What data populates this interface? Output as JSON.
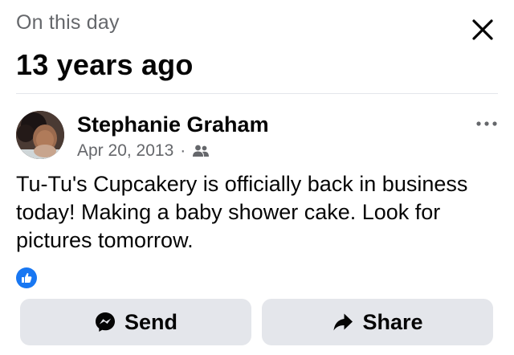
{
  "header": {
    "kicker": "On this day",
    "title": "13 years ago",
    "close_icon": "close-icon"
  },
  "post": {
    "author": "Stephanie Graham",
    "date": "Apr 20, 2013",
    "separator": "·",
    "audience_icon": "friends-icon",
    "more_icon": "more-horizontal-icon",
    "text": "Tu-Tu's Cupcakery is officially back in business today!  Making a baby shower cake.  Look for pictures tomorrow.",
    "reaction_icon": "like-icon"
  },
  "actions": {
    "send_label": "Send",
    "send_icon": "messenger-icon",
    "share_label": "Share",
    "share_icon": "share-arrow-icon"
  },
  "colors": {
    "accent": "#1877f2",
    "secondary_text": "#65676b",
    "button_bg": "#e4e6eb",
    "primary_text": "#050505"
  }
}
